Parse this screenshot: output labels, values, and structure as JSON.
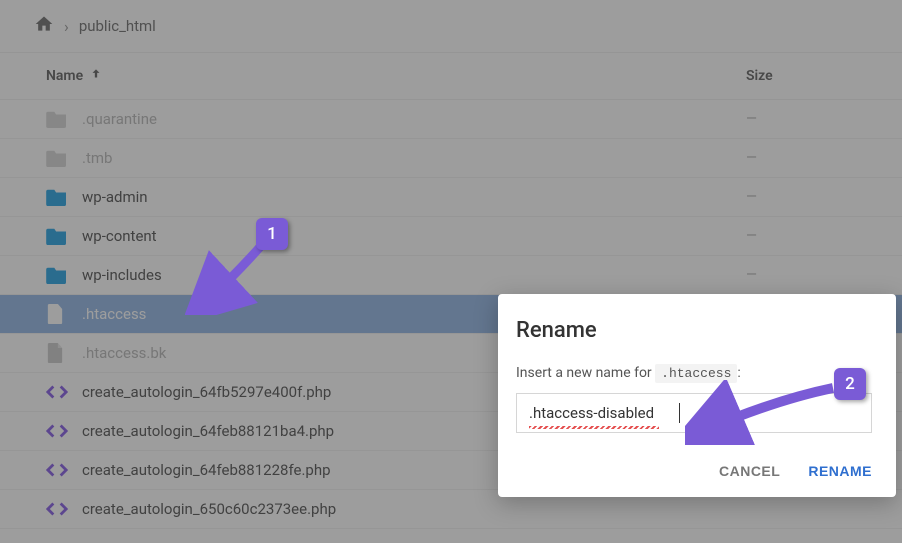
{
  "breadcrumb": {
    "current": "public_html"
  },
  "columns": {
    "name": "Name",
    "size": "Size"
  },
  "rows": [
    {
      "kind": "folder",
      "name": ".quarantine",
      "size": "—",
      "dimmed": true
    },
    {
      "kind": "folder",
      "name": ".tmb",
      "size": "—",
      "dimmed": true
    },
    {
      "kind": "folder",
      "name": "wp-admin",
      "size": "—"
    },
    {
      "kind": "folder",
      "name": "wp-content",
      "size": "—"
    },
    {
      "kind": "folder",
      "name": "wp-includes",
      "size": "—"
    },
    {
      "kind": "file",
      "name": ".htaccess",
      "size": "",
      "selected": true
    },
    {
      "kind": "file",
      "name": ".htaccess.bk",
      "size": "",
      "dimmed": true
    },
    {
      "kind": "code",
      "name": "create_autologin_64fb5297e400f.php",
      "size": ""
    },
    {
      "kind": "code",
      "name": "create_autologin_64feb88121ba4.php",
      "size": ""
    },
    {
      "kind": "code",
      "name": "create_autologin_64feb881228fe.php",
      "size": ""
    },
    {
      "kind": "code",
      "name": "create_autologin_650c60c2373ee.php",
      "size": ""
    }
  ],
  "dialog": {
    "title": "Rename",
    "prompt_prefix": "Insert a new name for ",
    "prompt_target": ".htaccess",
    "prompt_suffix": ":",
    "input_value": ".htaccess-disabled",
    "cancel": "CANCEL",
    "confirm": "RENAME"
  },
  "annotations": {
    "badge1": "1",
    "badge2": "2"
  }
}
